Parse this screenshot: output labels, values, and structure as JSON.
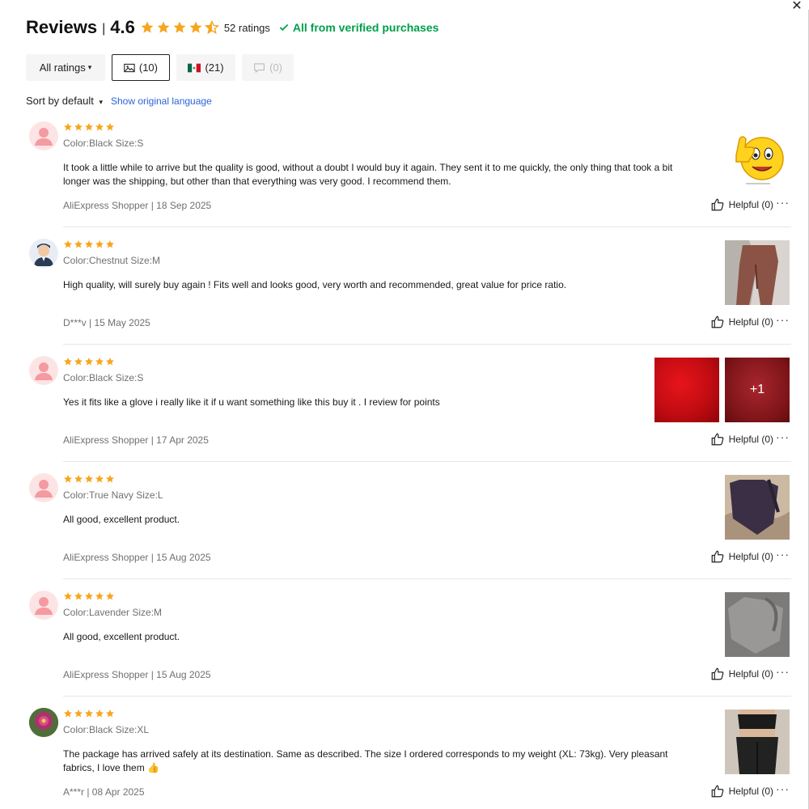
{
  "header": {
    "title": "Reviews",
    "separator": "|",
    "score": "4.6",
    "rating_value": 4.6,
    "ratings_count": "52 ratings",
    "verified": "All from verified purchases",
    "verified_color": "#00a04a"
  },
  "filters": {
    "all_label": "All ratings",
    "photo_count": "(10)",
    "country_count": "(21)",
    "comment_count": "(0)"
  },
  "sort": {
    "label": "Sort by default",
    "show_original": "Show original language"
  },
  "reviews": [
    {
      "stars": 5,
      "variant": "Color:Black Size:S",
      "text": "It took a little while to arrive but the quality is good, without a doubt I would buy it again. They sent it to me quickly, the only thing that took a bit longer was the shipping, but other than that everything was very good. I recommend them.",
      "author_date": "AliExpress Shopper | 18 Sep 2025",
      "helpful": "Helpful (0)"
    },
    {
      "stars": 5,
      "variant": "Color:Chestnut Size:M",
      "text": "High quality, will surely buy again ! Fits well and looks good, very worth and recommended, great value for price ratio.",
      "author_date": "D***v | 15 May 2025",
      "helpful": "Helpful (0)"
    },
    {
      "stars": 5,
      "variant": "Color:Black Size:S",
      "text": "Yes it fits like a glove i really like it if u want something like this buy it . I review for points",
      "author_date": "AliExpress Shopper | 17 Apr 2025",
      "helpful": "Helpful (0)",
      "more_photos": "+1"
    },
    {
      "stars": 5,
      "variant": "Color:True Navy Size:L",
      "text": "All good, excellent product.",
      "author_date": "AliExpress Shopper | 15 Aug 2025",
      "helpful": "Helpful (0)"
    },
    {
      "stars": 5,
      "variant": "Color:Lavender Size:M",
      "text": "All good, excellent product.",
      "author_date": "AliExpress Shopper | 15 Aug 2025",
      "helpful": "Helpful (0)"
    },
    {
      "stars": 5,
      "variant": "Color:Black Size:XL",
      "text": "The package has arrived safely at its destination. Same as described. The size I ordered corresponds to my weight (XL: 73kg). Very pleasant fabrics, I love them 👍",
      "author_date": "A***r | 08 Apr 2025",
      "helpful": "Helpful (0)"
    }
  ],
  "colors": {
    "star": "#f7a51c",
    "link": "#2a64d9",
    "muted": "#707070"
  }
}
